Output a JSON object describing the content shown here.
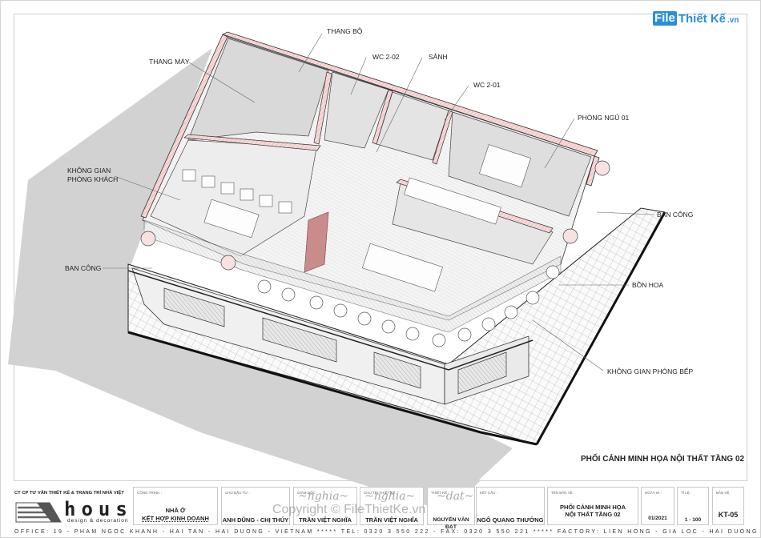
{
  "watermark": {
    "file": "File",
    "rest": "Thiết Kế",
    "vn": ".vn"
  },
  "labels": {
    "thang_bo": "THANG BỘ",
    "thang_may": "THANG MÁY",
    "wc_2_02": "WC 2-02",
    "sanh": "SẢNH",
    "wc_2_01": "WC 2-01",
    "phong_ngu_01": "PHÒNG NGỦ 01",
    "khong_gian_phong_khach_1": "KHÔNG GIAN",
    "khong_gian_phong_khach_2": "PHÒNG KHÁCH",
    "ban_cong_left": "BAN CÔNG",
    "ban_cong_right": "BAN CÔNG",
    "bon_hoa": "BỒN HOA",
    "khong_gian_phong_bep": "KHÔNG GIAN PHÒNG BẾP"
  },
  "sheet_title": "PHỐI CẢNH MINH HỌA NỘI THẤT TẦNG 02",
  "title_block": {
    "company": "CT CP TƯ VẤN THIẾT KẾ & TRANG TRÍ NHÀ VIỆT",
    "logo_word": "house",
    "logo_tagline": "design & decoration",
    "cong_trinh": {
      "caption": "CÔNG TRÌNH :",
      "line1": "NHÀ Ở",
      "line2": "KẾT HỢP KINH DOANH"
    },
    "chu_dau_tu": {
      "caption": "CHỦ ĐẦU TƯ :",
      "value": "ANH DŨNG - CHỊ THÚY"
    },
    "giam_doc": {
      "caption": "GIÁM ĐỐC :",
      "value": "TRẦN VIỆT NGHĨA"
    },
    "chu_tri_thiet_ke": {
      "caption": "CHỦ TRÌ THIẾT KẾ :",
      "value": "TRẦN VIỆT NGHĨA"
    },
    "thiet_ke": {
      "caption": "THIẾT KẾ :",
      "value": "NGUYỄN VĂN ĐẠT"
    },
    "ket_cau": {
      "caption": "KẾT CẤU :",
      "value": "NGÔ QUANG THƯỞNG"
    },
    "ten_ban_ve": {
      "caption": "TÊN BẢN VẼ :",
      "line1": "PHỐI CẢNH MINH HỌA",
      "line2": "NỘI THẤT TẦNG 02"
    },
    "ngay_in": {
      "caption": "NGÀY IN :",
      "value": "01/2021"
    },
    "ti_le": {
      "caption": "TỈ LỆ :",
      "value": "1 - 100"
    },
    "ban_ve": {
      "caption": "BẢN VẼ :",
      "value": "KT-05"
    },
    "footer": "OFFICE: 19 - PHAM NGOC KHANH - HAI TAN - HAI DUONG - VIETNAM ***** TEL: 0320 3 550 222 - FAX: 0320 3 550 221 ***** FACTORY: LIEN HONG - GIA LOC - HAI DUONG",
    "copyright": "Copyright © FileThietKe.vn"
  }
}
